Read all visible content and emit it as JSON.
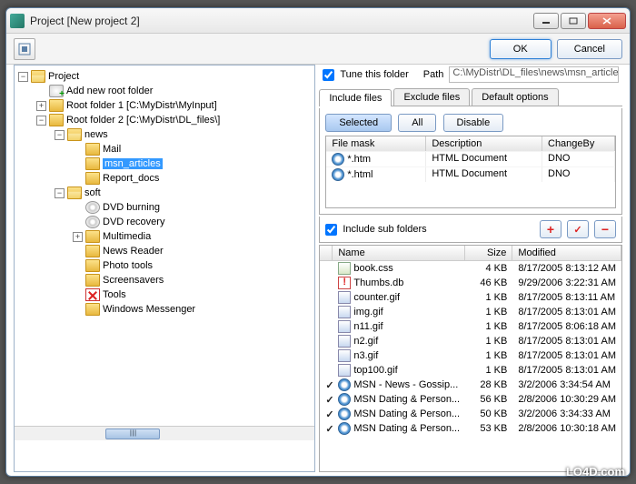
{
  "window": {
    "title": "Project [New project 2]"
  },
  "buttons": {
    "ok": "OK",
    "cancel": "Cancel"
  },
  "tree": {
    "root": "Project",
    "add": "Add new root folder",
    "rf1": "Root folder 1 [C:\\MyDistr\\MyInput]",
    "rf2": "Root folder 2 [C:\\MyDistr\\DL_files\\]",
    "news": "news",
    "mail": "Mail",
    "msn": "msn_articles",
    "report": "Report_docs",
    "soft": "soft",
    "dvdburn": "DVD burning",
    "dvdrec": "DVD recovery",
    "mm": "Multimedia",
    "nr": "News Reader",
    "photo": "Photo tools",
    "ss": "Screensavers",
    "tools": "Tools",
    "wm": "Windows Messenger"
  },
  "right": {
    "tune": "Tune this folder",
    "path_label": "Path",
    "path": "C:\\MyDistr\\DL_files\\news\\msn_articles\\",
    "tabs": [
      "Include files",
      "Exclude files",
      "Default options"
    ],
    "filter_btns": {
      "selected": "Selected",
      "all": "All",
      "disable": "Disable"
    },
    "mask_head": {
      "mask": "File mask",
      "desc": "Description",
      "chg": "ChangeBy"
    },
    "masks": [
      {
        "mask": "*.htm",
        "desc": "HTML Document",
        "chg": "DNO"
      },
      {
        "mask": "*.html",
        "desc": "HTML Document",
        "chg": "DNO"
      }
    ],
    "include_sub": "Include sub folders",
    "file_head": {
      "name": "Name",
      "size": "Size",
      "mod": "Modified"
    },
    "files": [
      {
        "c": "",
        "icon": "css",
        "name": "book.css",
        "size": "4 KB",
        "mod": "8/17/2005 8:13:12 AM"
      },
      {
        "c": "",
        "icon": "warn",
        "name": "Thumbs.db",
        "size": "46 KB",
        "mod": "9/29/2006 3:22:31 AM"
      },
      {
        "c": "",
        "icon": "gif",
        "name": "counter.gif",
        "size": "1 KB",
        "mod": "8/17/2005 8:13:11 AM"
      },
      {
        "c": "",
        "icon": "gif",
        "name": "img.gif",
        "size": "1 KB",
        "mod": "8/17/2005 8:13:01 AM"
      },
      {
        "c": "",
        "icon": "gif",
        "name": "n11.gif",
        "size": "1 KB",
        "mod": "8/17/2005 8:06:18 AM"
      },
      {
        "c": "",
        "icon": "gif",
        "name": "n2.gif",
        "size": "1 KB",
        "mod": "8/17/2005 8:13:01 AM"
      },
      {
        "c": "",
        "icon": "gif",
        "name": "n3.gif",
        "size": "1 KB",
        "mod": "8/17/2005 8:13:01 AM"
      },
      {
        "c": "",
        "icon": "gif",
        "name": "top100.gif",
        "size": "1 KB",
        "mod": "8/17/2005 8:13:01 AM"
      },
      {
        "c": "✓",
        "icon": "ie",
        "name": "MSN - News - Gossip...",
        "size": "28 KB",
        "mod": "3/2/2006 3:34:54 AM"
      },
      {
        "c": "✓",
        "icon": "ie",
        "name": "MSN Dating & Person...",
        "size": "56 KB",
        "mod": "2/8/2006 10:30:29 AM"
      },
      {
        "c": "✓",
        "icon": "ie",
        "name": "MSN Dating & Person...",
        "size": "50 KB",
        "mod": "3/2/2006 3:34:33 AM"
      },
      {
        "c": "✓",
        "icon": "ie",
        "name": "MSN Dating & Person...",
        "size": "53 KB",
        "mod": "2/8/2006 10:30:18 AM"
      }
    ]
  },
  "watermark": "LO4D.com"
}
